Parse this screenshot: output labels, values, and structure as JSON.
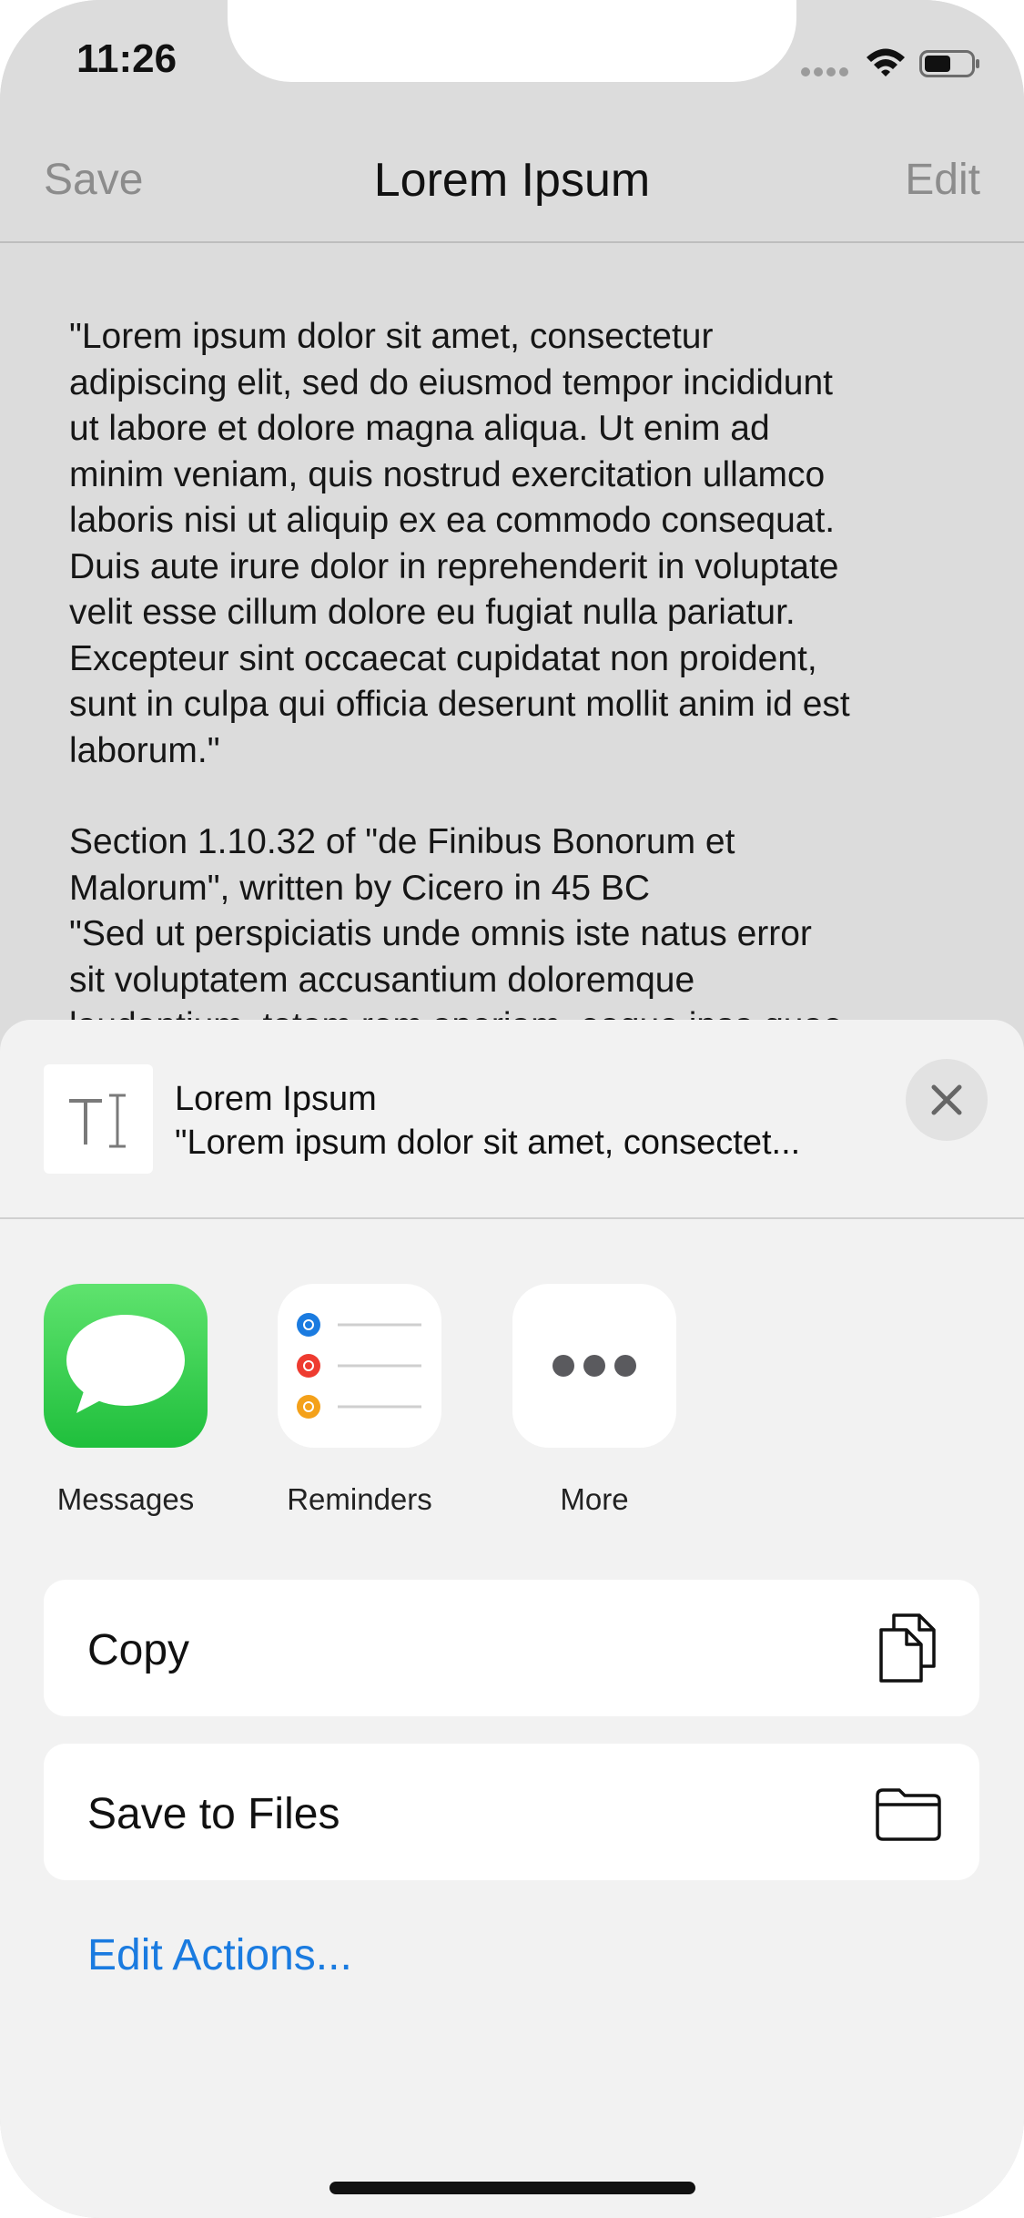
{
  "status": {
    "time": "11:26",
    "signal_icon": "cellular-signal-icon",
    "wifi_icon": "wifi-icon",
    "battery_icon": "battery-icon"
  },
  "nav": {
    "left": "Save",
    "title": "Lorem Ipsum",
    "right": "Edit"
  },
  "document": {
    "paragraph_1": "\"Lorem ipsum dolor sit amet, consectetur\nadipiscing elit, sed do eiusmod tempor incididunt\nut labore et dolore magna aliqua. Ut enim ad\nminim veniam, quis nostrud exercitation ullamco\nlaboris nisi ut aliquip ex ea commodo consequat.\nDuis aute irure dolor in reprehenderit in voluptate\nvelit esse cillum dolore eu fugiat nulla pariatur.\nExcepteur sint occaecat cupidatat non proident,\nsunt in culpa qui officia deserunt mollit anim id est\nlaborum.\"",
    "paragraph_2": "Section 1.10.32 of \"de Finibus Bonorum et\nMalorum\", written by Cicero in 45 BC\n\"Sed ut perspiciatis unde omnis iste natus error\nsit voluptatem accusantium doloremque\nlaudantium, totam rem aperiam, eaque ipsa quae"
  },
  "share_sheet": {
    "preview": {
      "title": "Lorem Ipsum",
      "subtitle": "\"Lorem ipsum dolor sit amet, consectet...",
      "icon": "text-document-icon",
      "close_icon": "close-icon"
    },
    "apps": [
      {
        "label": "Messages",
        "icon": "messages-icon",
        "color": "#30c84a"
      },
      {
        "label": "Reminders",
        "icon": "reminders-icon",
        "color": "#ffffff"
      },
      {
        "label": "More",
        "icon": "more-icon",
        "color": "#ffffff"
      }
    ],
    "actions": [
      {
        "label": "Copy",
        "icon": "copy-icon"
      },
      {
        "label": "Save to Files",
        "icon": "folder-icon"
      }
    ],
    "edit_actions": "Edit Actions...",
    "accent_color": "#1a7be0"
  }
}
